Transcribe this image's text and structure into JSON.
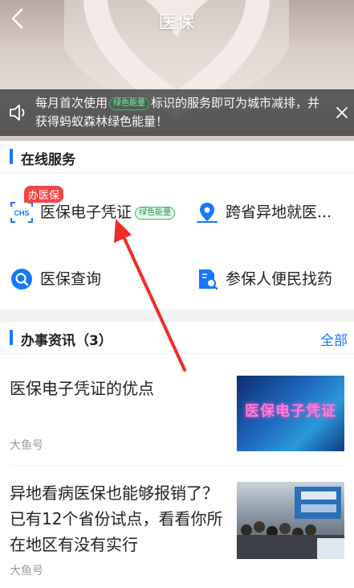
{
  "header": {
    "title": "医保"
  },
  "notice": {
    "text_before": "每月首次使用",
    "badge": "绿色能量",
    "text_after": "标识的服务即可为城市减排，并获得蚂蚁森林绿色能量！"
  },
  "online_services": {
    "title": "在线服务",
    "items": [
      {
        "label": "医保电子凭证",
        "badge": "绿色能量",
        "tag": "办医保",
        "icon": "chs-icon"
      },
      {
        "label": "跨省异地就医...",
        "icon": "location-icon"
      },
      {
        "label": "医保查询",
        "icon": "search-circle-icon"
      },
      {
        "label": "参保人便民找药",
        "icon": "document-search-icon"
      }
    ]
  },
  "news": {
    "title": "办事资讯（3）",
    "more": "全部",
    "items": [
      {
        "title": "医保电子凭证的优点",
        "source": "大鱼号",
        "thumb_text": "医保电子凭证"
      },
      {
        "title": "异地看病医保也能够报销了？已有12个省份试点，看看你所在地区有没有实行",
        "source": "大鱼号"
      }
    ]
  },
  "colors": {
    "accent": "#1677ff",
    "tag": "#f24646",
    "green": "#37b868"
  }
}
